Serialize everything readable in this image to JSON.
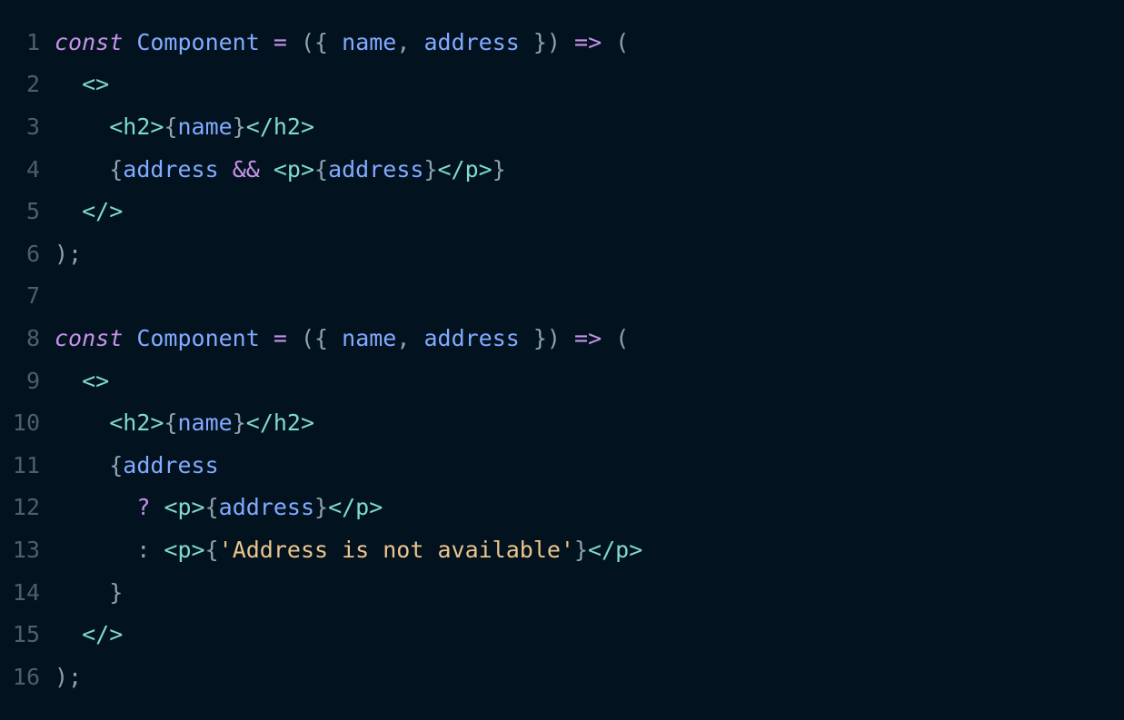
{
  "editor": {
    "background": "#02131f",
    "language": "jsx",
    "colors": {
      "keyword": "#c792ea",
      "identifier": "#82aaff",
      "operator": "#c792ea",
      "punctuation": "#8ea2b0",
      "tag": "#7fdbca",
      "string": "#ecc48d",
      "line_number": "#4f5e6a"
    },
    "lines": [
      {
        "number": "1",
        "tokens": [
          {
            "t": "const",
            "c": "keyword",
            "i": true
          },
          {
            "t": " ",
            "c": "punctuation"
          },
          {
            "t": "Component",
            "c": "identifier"
          },
          {
            "t": " ",
            "c": "punctuation"
          },
          {
            "t": "=",
            "c": "operator"
          },
          {
            "t": " ({ ",
            "c": "punctuation"
          },
          {
            "t": "name",
            "c": "identifier"
          },
          {
            "t": ", ",
            "c": "punctuation"
          },
          {
            "t": "address",
            "c": "identifier"
          },
          {
            "t": " }) ",
            "c": "punctuation"
          },
          {
            "t": "=>",
            "c": "operator"
          },
          {
            "t": " (",
            "c": "punctuation"
          }
        ]
      },
      {
        "number": "2",
        "tokens": [
          {
            "t": "  ",
            "c": "punctuation"
          },
          {
            "t": "<>",
            "c": "tag"
          }
        ]
      },
      {
        "number": "3",
        "tokens": [
          {
            "t": "    ",
            "c": "punctuation"
          },
          {
            "t": "<h2>",
            "c": "tag"
          },
          {
            "t": "{",
            "c": "punctuation"
          },
          {
            "t": "name",
            "c": "identifier"
          },
          {
            "t": "}",
            "c": "punctuation"
          },
          {
            "t": "</h2>",
            "c": "tag"
          }
        ]
      },
      {
        "number": "4",
        "tokens": [
          {
            "t": "    {",
            "c": "punctuation"
          },
          {
            "t": "address",
            "c": "identifier"
          },
          {
            "t": " ",
            "c": "punctuation"
          },
          {
            "t": "&&",
            "c": "operator"
          },
          {
            "t": " ",
            "c": "punctuation"
          },
          {
            "t": "<p>",
            "c": "tag"
          },
          {
            "t": "{",
            "c": "punctuation"
          },
          {
            "t": "address",
            "c": "identifier"
          },
          {
            "t": "}",
            "c": "punctuation"
          },
          {
            "t": "</p>",
            "c": "tag"
          },
          {
            "t": "}",
            "c": "punctuation"
          }
        ]
      },
      {
        "number": "5",
        "tokens": [
          {
            "t": "  ",
            "c": "punctuation"
          },
          {
            "t": "</>",
            "c": "tag"
          }
        ]
      },
      {
        "number": "6",
        "tokens": [
          {
            "t": ");",
            "c": "punctuation"
          }
        ]
      },
      {
        "number": "7",
        "tokens": []
      },
      {
        "number": "8",
        "tokens": [
          {
            "t": "const",
            "c": "keyword",
            "i": true
          },
          {
            "t": " ",
            "c": "punctuation"
          },
          {
            "t": "Component",
            "c": "identifier"
          },
          {
            "t": " ",
            "c": "punctuation"
          },
          {
            "t": "=",
            "c": "operator"
          },
          {
            "t": " ({ ",
            "c": "punctuation"
          },
          {
            "t": "name",
            "c": "identifier"
          },
          {
            "t": ", ",
            "c": "punctuation"
          },
          {
            "t": "address",
            "c": "identifier"
          },
          {
            "t": " }) ",
            "c": "punctuation"
          },
          {
            "t": "=>",
            "c": "operator"
          },
          {
            "t": " (",
            "c": "punctuation"
          }
        ]
      },
      {
        "number": "9",
        "tokens": [
          {
            "t": "  ",
            "c": "punctuation"
          },
          {
            "t": "<>",
            "c": "tag"
          }
        ]
      },
      {
        "number": "10",
        "tokens": [
          {
            "t": "    ",
            "c": "punctuation"
          },
          {
            "t": "<h2>",
            "c": "tag"
          },
          {
            "t": "{",
            "c": "punctuation"
          },
          {
            "t": "name",
            "c": "identifier"
          },
          {
            "t": "}",
            "c": "punctuation"
          },
          {
            "t": "</h2>",
            "c": "tag"
          }
        ]
      },
      {
        "number": "11",
        "tokens": [
          {
            "t": "    {",
            "c": "punctuation"
          },
          {
            "t": "address",
            "c": "identifier"
          }
        ]
      },
      {
        "number": "12",
        "tokens": [
          {
            "t": "      ",
            "c": "punctuation"
          },
          {
            "t": "?",
            "c": "operator"
          },
          {
            "t": " ",
            "c": "punctuation"
          },
          {
            "t": "<p>",
            "c": "tag"
          },
          {
            "t": "{",
            "c": "punctuation"
          },
          {
            "t": "address",
            "c": "identifier"
          },
          {
            "t": "}",
            "c": "punctuation"
          },
          {
            "t": "</p>",
            "c": "tag"
          }
        ]
      },
      {
        "number": "13",
        "tokens": [
          {
            "t": "      : ",
            "c": "punctuation"
          },
          {
            "t": "<p>",
            "c": "tag"
          },
          {
            "t": "{",
            "c": "punctuation"
          },
          {
            "t": "'Address is not available'",
            "c": "string"
          },
          {
            "t": "}",
            "c": "punctuation"
          },
          {
            "t": "</p>",
            "c": "tag"
          }
        ]
      },
      {
        "number": "14",
        "tokens": [
          {
            "t": "    }",
            "c": "punctuation"
          }
        ]
      },
      {
        "number": "15",
        "tokens": [
          {
            "t": "  ",
            "c": "punctuation"
          },
          {
            "t": "</>",
            "c": "tag"
          }
        ]
      },
      {
        "number": "16",
        "tokens": [
          {
            "t": ");",
            "c": "punctuation"
          }
        ]
      }
    ]
  }
}
